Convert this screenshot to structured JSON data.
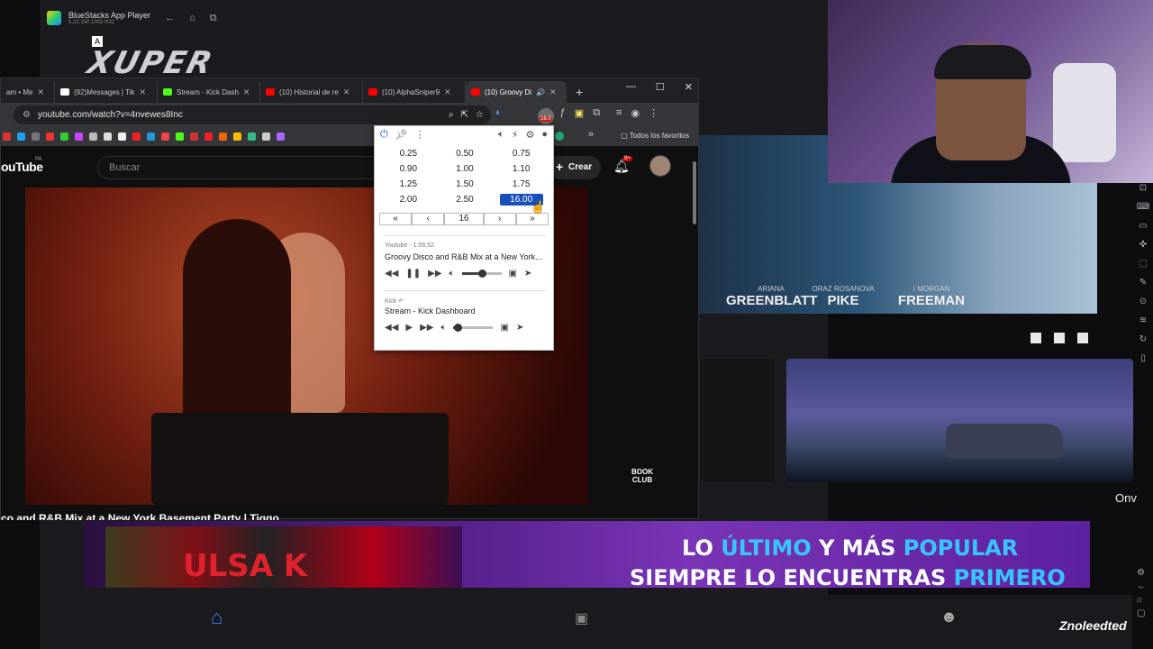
{
  "bluestacks": {
    "title": "BlueStacks App Player",
    "subtitle": "5.22.150.1003  N32",
    "logo_text": "XUPER",
    "poster_names": [
      {
        "pre": "ARIANA",
        "name": "GREENBLATT"
      },
      {
        "pre": "ORAZ ROSANOVA",
        "name": "PIKE"
      },
      {
        "pre": "I MORGAN",
        "name": "FREEMAN"
      }
    ],
    "side_text": "Onv",
    "banner": {
      "line1_a": "LO ",
      "line1_b": "ÚLTIMO",
      "line1_c": " Y MÁS ",
      "line1_d": "POPULAR",
      "line2_a": "SIEMPRE LO ENCUENTRAS ",
      "line2_b": "PRIMERO",
      "img_text": "ULSA K"
    },
    "bottom_nav": [
      "home-icon",
      "tv-icon",
      "alien-icon"
    ],
    "signature": "Znoleedted"
  },
  "chrome": {
    "tabs": [
      {
        "label": "am • Me",
        "icon": "instagram",
        "color": "#e1306c"
      },
      {
        "label": "(92)Messages | Tik",
        "icon": "tiktok",
        "color": "#ffffff"
      },
      {
        "label": "Stream - Kick Dash",
        "icon": "kick",
        "color": "#53fc18"
      },
      {
        "label": "(10) Historial de re",
        "icon": "youtube",
        "color": "#ff0000"
      },
      {
        "label": "(10) AlphaSniper9",
        "icon": "youtube",
        "color": "#ff0000"
      },
      {
        "label": "(10) Groovy Di",
        "icon": "youtube",
        "color": "#ff0000",
        "active": true
      }
    ],
    "url": "youtube.com/watch?v=4nvewes8Inc",
    "bookmarks_all": "Todos los favoritos",
    "speed_badge": "16.0"
  },
  "youtube": {
    "logo": "ouTube",
    "region": "PA",
    "search_placeholder": "Buscar",
    "create_label": "Crear",
    "notif_count": "9+",
    "watermark": "BOOK\nCLUB",
    "video_title": "co and R&B Mix at a New York Basement Party | Tiggo"
  },
  "popup": {
    "speeds": [
      "0.25",
      "0.50",
      "0.75",
      "0.90",
      "1.00",
      "1.10",
      "1.25",
      "1.50",
      "1.75",
      "2.00",
      "2.50",
      "16.00"
    ],
    "selected_speed": "16.00",
    "stepper": [
      "«",
      "‹",
      "16",
      "›",
      "»"
    ],
    "media": [
      {
        "source": "Youtube - 1:06:52",
        "title": "Groovy Disco and R&B Mix at a New York...",
        "playing": true,
        "volume": 0.5
      },
      {
        "source": "Kick",
        "title": "Stream - Kick Dashboard",
        "playing": false,
        "volume": 0.1
      }
    ]
  }
}
